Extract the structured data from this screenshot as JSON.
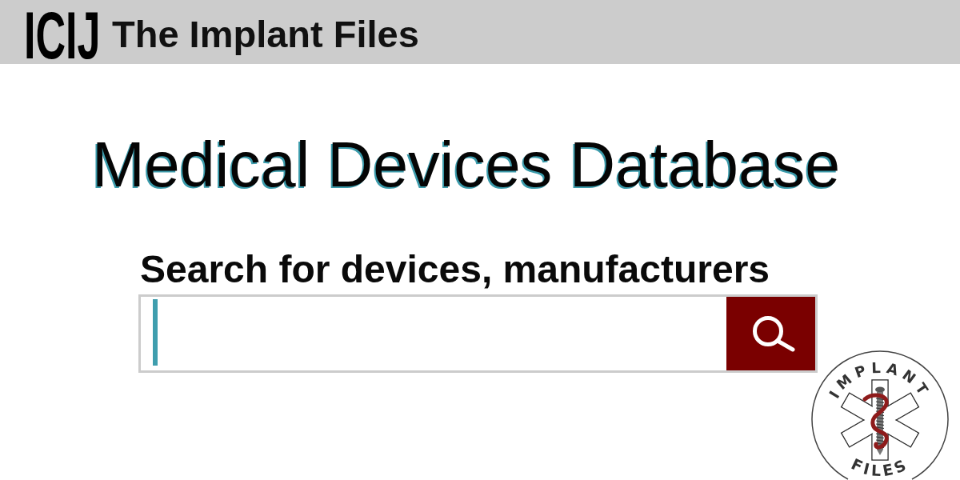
{
  "header": {
    "logo": "ICIJ",
    "title": "The Implant Files"
  },
  "page": {
    "heading": "Medical Devices Database",
    "search_label": "Search for devices, manufacturers",
    "search_field": {
      "focused": true
    }
  },
  "badge": {
    "top_text": "IMPLANT",
    "bottom_text": "FILES"
  }
}
